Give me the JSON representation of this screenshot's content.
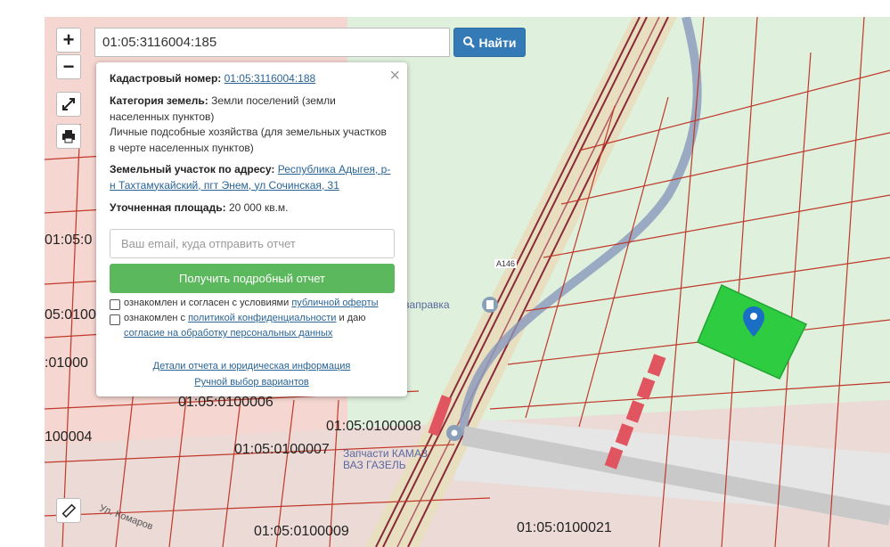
{
  "search": {
    "value": "01:05:3116004:185",
    "button_label": "Найти"
  },
  "zoom": {
    "in_label": "+",
    "out_label": "−"
  },
  "popup": {
    "close_label": "×",
    "cadastral_label": "Кадастровый номер:",
    "cadastral_value": "01:05:3116004:188",
    "category_label": "Категория земель:",
    "category_value_1": "Земли поселений (земли",
    "category_value_2": "населенных пунктов)",
    "use_1": "Личные подсобные хозяйства (для земельных участков",
    "use_2": "в черте населенных пунктов)",
    "address_label": "Земельный участок по адресу:",
    "address_value_1": "Республика Адыгея, р-",
    "address_value_2": "н Тахтамукайский, пгт Энем, ул Сочинская, 31",
    "area_label": "Уточненная площадь:",
    "area_value": "20 000 кв.м.",
    "email_placeholder": "Ваш email, куда отправить отчет",
    "get_report": "Получить подробный отчет",
    "agree1_text": "ознакомлен и согласен с условиями",
    "agree1_link": "публичной оферты",
    "agree2_text": "ознакомлен с",
    "agree2_link": "политикой конфиденциальности",
    "agree2_text2": "и даю",
    "agree2_link2": "согласие на обработку персональных данных",
    "details_link": "Детали отчета и юридическая информация",
    "manual_link": "Ручной выбор вариантов"
  },
  "map_labels": {
    "l1": "01:05:0",
    "l2": "05:0100",
    "l3": ":01000",
    "l4": "01:05:0100006",
    "l5": "01:05:0100008",
    "l6": "100004",
    "l7": "01:05:0100007",
    "l8": "01:05:0100009",
    "l9": "01:05:0100021",
    "road": "A146",
    "gas": "Автозаправка",
    "shop": "Запчасти КАМАЗ ВАЗ ГАЗЕЛЬ",
    "street": "Ул. Комаров"
  },
  "colors": {
    "parcel_line": "#c0392b",
    "selected_parcel": "#2ecc40",
    "road": "#8899bb"
  }
}
